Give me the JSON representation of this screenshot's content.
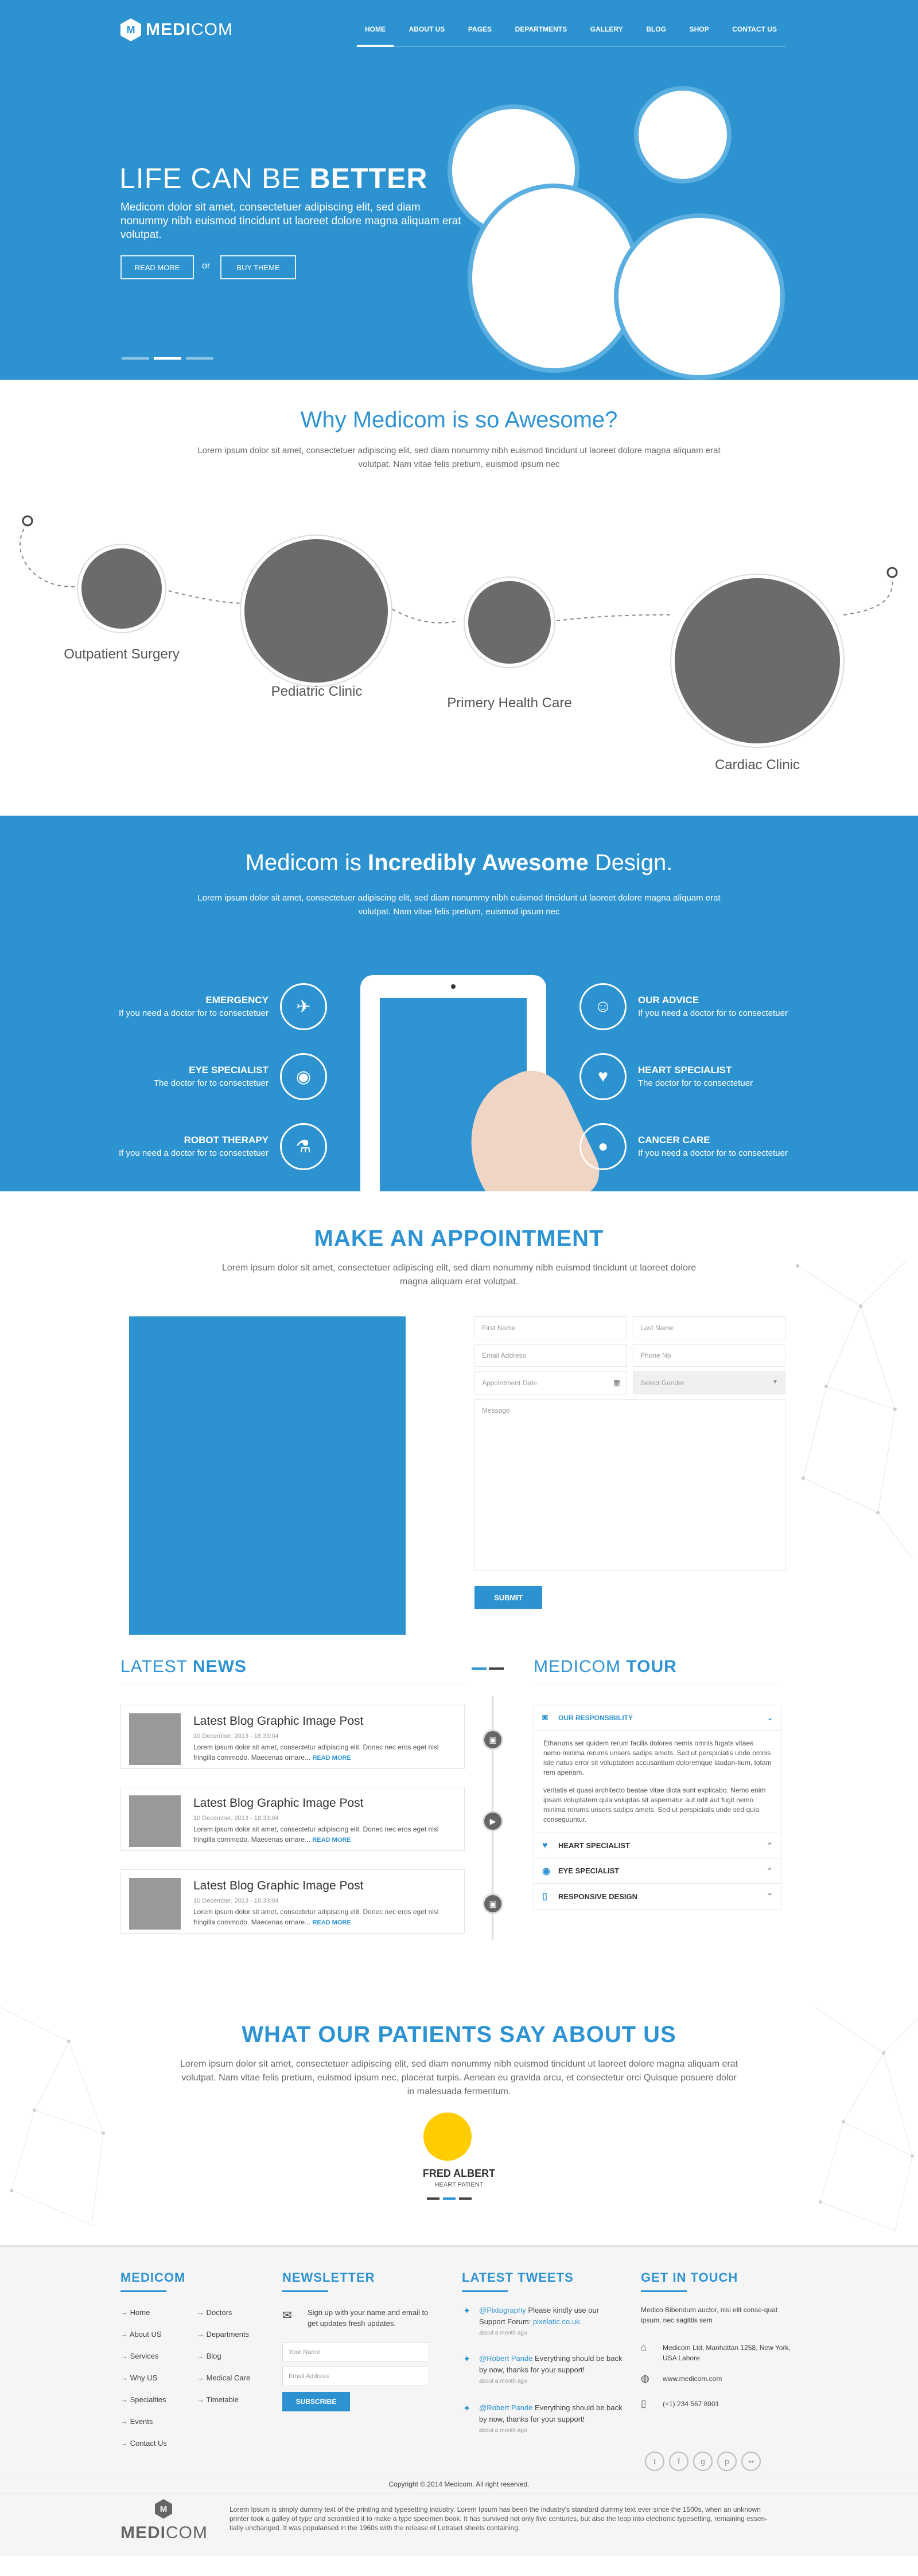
{
  "header": {
    "logo_letter": "M",
    "brand_bold": "MEDI",
    "brand_light": "COM",
    "nav": [
      "HOME",
      "ABOUT US",
      "PAGES",
      "DEPARTMENTS",
      "GALLERY",
      "BLOG",
      "SHOP",
      "CONTACT US"
    ]
  },
  "hero": {
    "title_light": "LIFE CAN BE ",
    "title_bold": "BETTER",
    "text": "Medicom dolor sit amet, consectetuer adipiscing elit, sed diam nonummy nibh euismod tincidunt ut laoreet dolore magna aliquam erat volutpat.",
    "read_more": "READ MORE",
    "or": "or",
    "buy_theme": "BUY THEME"
  },
  "why": {
    "title": "Why Medicom is so Awesome?",
    "text": "Lorem ipsum dolor sit amet, consectetuer adipiscing elit, sed diam nonummy nibh euismod tincidunt ut laoreet dolore magna aliquam erat volutpat. Nam vitae felis pretium, euismod ipsum nec",
    "clinics": [
      "Outpatient Surgery",
      "Pediatric Clinic",
      "Primery Health Care",
      "Cardiac Clinic"
    ]
  },
  "features": {
    "title_light": "Medicom is ",
    "title_bold": "Incredibly Awesome",
    "title_end": " Design.",
    "text": "Lorem ipsum dolor sit amet, consectetuer adipiscing elit, sed diam nonummy nibh euismod tincidunt ut laoreet dolore magna aliquam erat volutpat. Nam vitae felis pretium, euismod ipsum nec",
    "left": [
      {
        "title": "EMERGENCY",
        "desc": "If you need a doctor for to consectetuer",
        "icon": "helicopter-icon"
      },
      {
        "title": "EYE SPECIALIST",
        "desc": "The doctor for to consectetuer",
        "icon": "eye-icon"
      },
      {
        "title": "ROBOT THERAPY",
        "desc": "If you need a doctor for to consectetuer",
        "icon": "flask-icon"
      }
    ],
    "right": [
      {
        "title": "OUR ADVICE",
        "desc": "If you need a doctor for to consectetuer",
        "icon": "doctor-icon"
      },
      {
        "title": "HEART SPECIALIST",
        "desc": "The doctor for to consectetuer",
        "icon": "heart-icon"
      },
      {
        "title": "CANCER CARE",
        "desc": "If you need a doctor for to consectetuer",
        "icon": "drop-icon"
      }
    ]
  },
  "appointment": {
    "title": "MAKE AN APPOINTMENT",
    "text": "Lorem ipsum dolor sit amet, consectetuer adipiscing elit, sed diam nonummy nibh euismod tincidunt ut laoreet dolore magna aliquam erat volutpat.",
    "first_name": "First Name",
    "last_name": "Last Name",
    "email": "Email Address",
    "phone": "Phone No",
    "date": "Appointment Date",
    "gender": "Select Gender",
    "message": "Message",
    "submit": "SUBMIT"
  },
  "news": {
    "title_light": "LATEST ",
    "title_bold": "NEWS",
    "posts": [
      {
        "title": "Latest Blog Graphic Image Post",
        "date": "10 December, 2013 - 18:33:04",
        "text": "Lorem ipsum dolor sit amet, consectetur adipiscing elit. Donec nec eros eget nisl fringilla commodo. Maecenas ornare...",
        "more": "READ MORE"
      },
      {
        "title": "Latest Blog Graphic Image Post",
        "date": "10 December, 2013 - 18:33:04",
        "text": "Lorem ipsum dolor sit amet, consectetur adipiscing elit. Donec nec eros eget nisl fringilla commodo. Maecenas ornare...",
        "more": "READ MORE"
      },
      {
        "title": "Latest Blog Graphic Image Post",
        "date": "10 December, 2013 - 18:33:04",
        "text": "Lorem ipsum dolor sit amet, consectetur adipiscing elit. Donec nec eros eget nisl fringilla commodo. Maecenas ornare...",
        "more": "READ MORE"
      }
    ]
  },
  "tour": {
    "title_light": "MEDICOM ",
    "title_bold": "TOUR",
    "open_title": "OUR RESPONSIBILITY",
    "para1": "Etharums ser quidem rerum facilis dolores nemis omnis fugats vitaes nemo minima rerums unsers sadips amets.  Sed ut perspiciatis unde omnis iste natus error sit voluptatem accusantium doloremque laudan-tium, totam rem aperiam.",
    "para2": "veritatis et quasi architecto beatae vitae dicta sunt explicabo. Nemo enim ipsam voluptatem quia voluptas sit aspernatur aut odit aut fugit nemo minima rerums unsers sadips amets.  Sed ut perspiciatis unde sed quia consequuntur.",
    "items": [
      "HEART SPECIALIST",
      "EYE SPECIALIST",
      "RESPONSIVE DESIGN"
    ]
  },
  "testimonials": {
    "title": "WHAT OUR PATIENTS SAY ABOUT US",
    "text": "Lorem ipsum dolor sit amet, consectetuer adipiscing elit, sed diam nonummy nibh euismod tincidunt ut laoreet dolore magna aliquam erat volutpat. Nam vitae felis pretium, euismod ipsum nec, placerat turpis. Aenean eu gravida arcu, et consectetur orci Quisque posuere dolor in malesuada fermentum.",
    "name": "FRED ALBERT",
    "role": "HEART PATIENT",
    "accent": "#ffcc00"
  },
  "footer": {
    "col1_title": "MEDICOM",
    "links_a": [
      "Home",
      "About US",
      "Services",
      "Why US",
      "Specialties",
      "Events",
      "Contact Us"
    ],
    "links_b": [
      "Doctors",
      "Departments",
      "Blog",
      "Medical Care",
      "Timetable"
    ],
    "news_title": "NEWSLETTER",
    "news_text": "Sign up with your name and email to get updates fresh updates.",
    "your_name": "Your Name",
    "email_addr": "Email Address",
    "subscribe": "SUBSCRIBE",
    "tweets_title": "LATEST TWEETS",
    "tweets": [
      {
        "handle": "@Pixtography",
        "text": " Please kindly use our Support Forum: ",
        "link": "pixelatic.co.uk.",
        "time": "about a month ago"
      },
      {
        "handle": "@Robert Pande",
        "text": " Everything should be back by now, thanks for your support!",
        "link": "",
        "time": "about a month ago"
      },
      {
        "handle": "@Robert Pande",
        "text": " Everything should be back by now, thanks for your support!",
        "link": "",
        "time": "about a month ago"
      }
    ],
    "touch_title": "GET IN TOUCH",
    "touch_text": "Medico Bibendum auctor, nisi elit conse-quat ipsum, nec sagittis sem",
    "address": "Medicom Ltd, Manhattan 1258, New York, USA Lahore",
    "website": "www.medicom.com",
    "phone": "(+1) 234 567 8901",
    "copyright": "Copyright © 2014 Medicom. All right reserved."
  },
  "bottom": {
    "brand_bold": "MEDI",
    "brand_light": "COM",
    "text": "Lorem Ipsum is simply dummy text of the printing and typesetting industry. Lorem Ipsum has been the industry's standard dummy text ever since the 1500s, when an unknown printer took a galley of type and scrambled it to make a type specimen book. It has survived not only five centuries, but also the leap into electronic typesetting, remaining essen-tially unchanged. It was popularised in the 1960s with the release of Letraset sheets containing."
  }
}
